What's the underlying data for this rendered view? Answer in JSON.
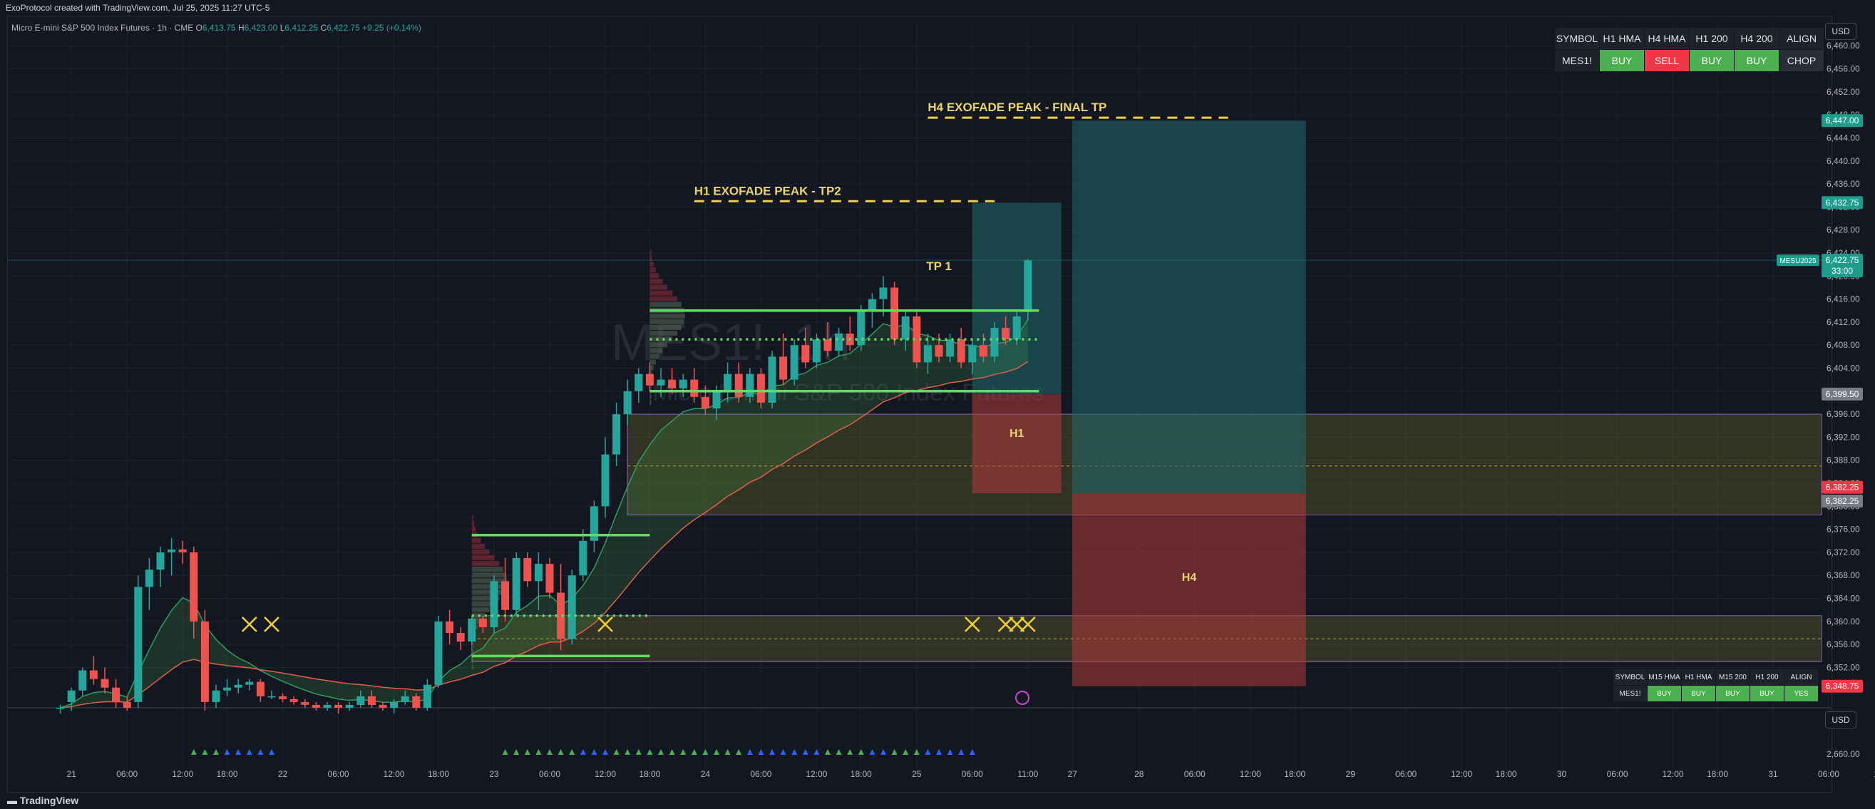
{
  "header": {
    "title": "ExoProtocol created with TradingView.com, Jul 25, 2025 11:27 UTC-5"
  },
  "infoline": {
    "symbol": "Micro E-mini S&P 500 Index Futures · 1h · CME",
    "o_label": "O",
    "o": "6,413.75",
    "h_label": "H",
    "h": "6,423.00",
    "l_label": "L",
    "l": "6,412.25",
    "c_label": "C",
    "c": "6,422.75",
    "change": "+9.25 (+0.14%)"
  },
  "currency_label": "USD",
  "footer": {
    "logo": "TradingView"
  },
  "watermark": {
    "symbol": "MES1!, 1h",
    "name": "Micro E-mini S&P 500 Index Futures"
  },
  "table_top": {
    "headers": [
      "SYMBOL",
      "H1 HMA",
      "H4 HMA",
      "H1 200",
      "H4 200",
      "ALIGN"
    ],
    "row": [
      "MES1!",
      "BUY",
      "SELL",
      "BUY",
      "BUY",
      "CHOP"
    ]
  },
  "table_bottom": {
    "headers": [
      "SYMBOL",
      "M15 HMA",
      "H1 HMA",
      "M15 200",
      "H1 200",
      "ALIGN"
    ],
    "row": [
      "MES1!",
      "BUY",
      "BUY",
      "BUY",
      "BUY",
      "YES"
    ]
  },
  "colors": {
    "background": "#131722",
    "up": "#26a69a",
    "down": "#ef5350",
    "level_line": "#5ee05a",
    "annotation": "#e8d66c",
    "zone_h1": "#a0a030",
    "zone_red": "#b03a3a",
    "zone_teal": "#1f6a6a"
  },
  "chart_data": {
    "type": "candlestick",
    "timeframe": "1h",
    "ylim": [
      6345,
      6463
    ],
    "y_ticks": [
      "6,460.00",
      "6,456.00",
      "6,452.00",
      "6,448.00",
      "6,444.00",
      "6,440.00",
      "6,436.00",
      "6,432.00",
      "6,428.00",
      "6,424.00",
      "6,420.00",
      "6,416.00",
      "6,412.00",
      "6,408.00",
      "6,404.00",
      "6,400.00",
      "6,396.00",
      "6,392.00",
      "6,388.00",
      "6,384.00",
      "6,380.00",
      "6,376.00",
      "6,372.00",
      "6,368.00",
      "6,364.00",
      "6,360.00",
      "6,356.00",
      "6,352.00"
    ],
    "x_ticks": [
      {
        "label": "21",
        "bar": 1
      },
      {
        "label": "06:00",
        "bar": 6
      },
      {
        "label": "12:00",
        "bar": 11
      },
      {
        "label": "18:00",
        "bar": 15
      },
      {
        "label": "22",
        "bar": 20
      },
      {
        "label": "06:00",
        "bar": 25
      },
      {
        "label": "12:00",
        "bar": 30
      },
      {
        "label": "18:00",
        "bar": 34
      },
      {
        "label": "23",
        "bar": 39
      },
      {
        "label": "06:00",
        "bar": 44
      },
      {
        "label": "12:00",
        "bar": 49
      },
      {
        "label": "18:00",
        "bar": 53
      },
      {
        "label": "24",
        "bar": 58
      },
      {
        "label": "06:00",
        "bar": 63
      },
      {
        "label": "12:00",
        "bar": 68
      },
      {
        "label": "18:00",
        "bar": 72
      },
      {
        "label": "25",
        "bar": 77
      },
      {
        "label": "06:00",
        "bar": 82
      },
      {
        "label": "11:00",
        "bar": 87
      },
      {
        "label": "27",
        "bar": 91
      },
      {
        "label": "28",
        "bar": 97
      },
      {
        "label": "06:00",
        "bar": 102
      },
      {
        "label": "12:00",
        "bar": 107
      },
      {
        "label": "18:00",
        "bar": 111
      },
      {
        "label": "29",
        "bar": 116
      },
      {
        "label": "06:00",
        "bar": 121
      },
      {
        "label": "12:00",
        "bar": 126
      },
      {
        "label": "18:00",
        "bar": 130
      },
      {
        "label": "30",
        "bar": 135
      },
      {
        "label": "06:00",
        "bar": 140
      },
      {
        "label": "12:00",
        "bar": 145
      },
      {
        "label": "18:00",
        "bar": 149
      },
      {
        "label": "31",
        "bar": 154
      },
      {
        "label": "06:00",
        "bar": 159
      },
      {
        "label": "12:00",
        "bar": 164
      }
    ],
    "candles": [
      [
        6345.0,
        6345.5,
        6344.0,
        6345.0
      ],
      [
        6346.0,
        6348.5,
        6344.5,
        6348.0
      ],
      [
        6348.0,
        6352.0,
        6347.0,
        6351.5
      ],
      [
        6351.5,
        6354.0,
        6349.0,
        6350.0
      ],
      [
        6350.0,
        6352.0,
        6347.5,
        6348.5
      ],
      [
        6348.5,
        6350.0,
        6345.0,
        6346.0
      ],
      [
        6346.0,
        6347.0,
        6344.5,
        6345.0
      ],
      [
        6346.0,
        6368.0,
        6345.0,
        6366.0
      ],
      [
        6366.0,
        6371.0,
        6362.0,
        6369.0
      ],
      [
        6369.0,
        6373.0,
        6366.0,
        6372.0
      ],
      [
        6372.0,
        6374.5,
        6368.0,
        6372.5
      ],
      [
        6372.5,
        6374.0,
        6370.0,
        6372.0
      ],
      [
        6372.0,
        6373.0,
        6357.0,
        6360.0
      ],
      [
        6360.0,
        6362.0,
        6344.5,
        6346.0
      ],
      [
        6346.0,
        6349.0,
        6345.0,
        6348.0
      ],
      [
        6348.0,
        6350.0,
        6347.0,
        6348.5
      ],
      [
        6348.5,
        6350.0,
        6347.5,
        6349.0
      ],
      [
        6349.0,
        6350.0,
        6348.0,
        6349.5
      ],
      [
        6349.5,
        6350.0,
        6346.0,
        6347.0
      ],
      [
        6347.0,
        6348.0,
        6346.5,
        6347.0
      ],
      [
        6347.0,
        6347.5,
        6346.0,
        6346.5
      ],
      [
        6346.5,
        6347.0,
        6345.5,
        6346.0
      ],
      [
        6346.0,
        6346.5,
        6345.0,
        6345.5
      ],
      [
        6345.5,
        6346.0,
        6344.5,
        6345.0
      ],
      [
        6345.0,
        6346.0,
        6344.5,
        6345.5
      ],
      [
        6345.5,
        6346.0,
        6344.0,
        6345.0
      ],
      [
        6345.0,
        6346.0,
        6344.5,
        6345.5
      ],
      [
        6345.5,
        6348.0,
        6345.0,
        6347.0
      ],
      [
        6347.0,
        6348.0,
        6345.0,
        6345.5
      ],
      [
        6345.5,
        6346.0,
        6344.5,
        6345.0
      ],
      [
        6345.0,
        6346.5,
        6344.0,
        6346.0
      ],
      [
        6346.0,
        6348.0,
        6345.5,
        6347.0
      ],
      [
        6347.0,
        6347.5,
        6344.5,
        6345.0
      ],
      [
        6345.0,
        6350.0,
        6344.5,
        6349.0
      ],
      [
        6349.0,
        6361.0,
        6348.5,
        6360.0
      ],
      [
        6360.0,
        6362.0,
        6356.0,
        6358.0
      ],
      [
        6358.0,
        6359.0,
        6355.0,
        6356.5
      ],
      [
        6356.5,
        6361.0,
        6356.0,
        6360.5
      ],
      [
        6360.5,
        6361.0,
        6358.0,
        6359.0
      ],
      [
        6359.0,
        6368.0,
        6358.0,
        6367.0
      ],
      [
        6367.0,
        6371.0,
        6360.0,
        6362.0
      ],
      [
        6362.0,
        6372.0,
        6361.0,
        6371.0
      ],
      [
        6371.0,
        6372.0,
        6366.0,
        6367.0
      ],
      [
        6367.0,
        6372.0,
        6362.0,
        6370.0
      ],
      [
        6370.0,
        6371.0,
        6364.0,
        6365.0
      ],
      [
        6365.0,
        6370.0,
        6355.0,
        6357.0
      ],
      [
        6357.0,
        6369.0,
        6356.0,
        6368.0
      ],
      [
        6368.0,
        6376.0,
        6367.0,
        6374.0
      ],
      [
        6374.0,
        6381.0,
        6372.0,
        6380.0
      ],
      [
        6380.0,
        6392.0,
        6378.0,
        6389.0
      ],
      [
        6389.0,
        6398.0,
        6387.0,
        6396.0
      ],
      [
        6396.0,
        6402.0,
        6394.0,
        6400.0
      ],
      [
        6400.0,
        6404.0,
        6398.0,
        6403.0
      ],
      [
        6403.0,
        6405.0,
        6400.0,
        6401.0
      ],
      [
        6401.0,
        6404.0,
        6399.0,
        6402.0
      ],
      [
        6402.0,
        6404.0,
        6399.5,
        6400.5
      ],
      [
        6400.5,
        6403.0,
        6399.0,
        6402.0
      ],
      [
        6402.0,
        6404.0,
        6398.0,
        6399.0
      ],
      [
        6399.0,
        6401.0,
        6396.0,
        6397.0
      ],
      [
        6397.0,
        6401.0,
        6395.0,
        6400.0
      ],
      [
        6400.0,
        6405.0,
        6398.0,
        6403.0
      ],
      [
        6403.0,
        6405.0,
        6398.0,
        6399.0
      ],
      [
        6399.0,
        6404.0,
        6398.0,
        6403.0
      ],
      [
        6403.0,
        6404.0,
        6397.0,
        6398.0
      ],
      [
        6398.0,
        6407.0,
        6397.0,
        6406.0
      ],
      [
        6406.0,
        6410.0,
        6401.0,
        6402.0
      ],
      [
        6402.0,
        6409.0,
        6401.0,
        6408.0
      ],
      [
        6408.0,
        6411.0,
        6404.0,
        6405.0
      ],
      [
        6405.0,
        6410.0,
        6404.0,
        6409.0
      ],
      [
        6409.0,
        6412.0,
        6406.0,
        6407.0
      ],
      [
        6407.0,
        6411.0,
        6406.0,
        6410.0
      ],
      [
        6410.0,
        6413.0,
        6407.0,
        6408.0
      ],
      [
        6408.0,
        6415.0,
        6407.0,
        6414.0
      ],
      [
        6414.0,
        6417.0,
        6411.0,
        6416.0
      ],
      [
        6416.0,
        6420.0,
        6413.0,
        6418.0
      ],
      [
        6418.0,
        6419.0,
        6408.0,
        6409.0
      ],
      [
        6409.0,
        6414.0,
        6407.0,
        6413.0
      ],
      [
        6413.0,
        6414.0,
        6404.0,
        6405.0
      ],
      [
        6405.0,
        6410.0,
        6403.0,
        6408.0
      ],
      [
        6408.0,
        6410.0,
        6405.0,
        6406.0
      ],
      [
        6406.0,
        6410.0,
        6405.0,
        6409.0
      ],
      [
        6409.0,
        6411.0,
        6404.0,
        6405.0
      ],
      [
        6405.0,
        6409.0,
        6403.0,
        6408.0
      ],
      [
        6408.0,
        6410.0,
        6405.0,
        6406.0
      ],
      [
        6406.0,
        6412.0,
        6405.0,
        6411.0
      ],
      [
        6411.0,
        6413.0,
        6408.0,
        6409.0
      ],
      [
        6409.0,
        6414.0,
        6408.0,
        6413.0
      ],
      [
        6413.75,
        6423.0,
        6412.25,
        6422.75
      ]
    ],
    "candle_start_bar": 0,
    "levels": [
      {
        "bar_start": 53,
        "bar_end": 88,
        "price": 6414.0,
        "style": "solid"
      },
      {
        "bar_start": 53,
        "bar_end": 88,
        "price": 6409.0,
        "style": "dotted"
      },
      {
        "bar_start": 53,
        "bar_end": 88,
        "price": 6400.0,
        "style": "solid"
      },
      {
        "bar_start": 37,
        "bar_end": 53,
        "price": 6375.0,
        "style": "solid"
      },
      {
        "bar_start": 37,
        "bar_end": 53,
        "price": 6361.0,
        "style": "dotted"
      },
      {
        "bar_start": 37,
        "bar_end": 53,
        "price": 6354.0,
        "style": "solid"
      }
    ],
    "zones": [
      {
        "id": "h1",
        "label": "H1",
        "bar_start": 51,
        "bar_end": 170,
        "top": 6396.0,
        "bottom": 6378.5,
        "mid": 6387.0
      },
      {
        "id": "lower",
        "label": "",
        "bar_start": 37,
        "bar_end": 170,
        "top": 6361.0,
        "bottom": 6353.0,
        "mid": 6357.0
      }
    ],
    "positions": [
      {
        "id": "h1-pos",
        "bar_start": 82,
        "bar_end": 90,
        "entry": 6399.5,
        "target": 6432.75,
        "stop": 6382.25,
        "label": "H1"
      },
      {
        "id": "h4-pos",
        "bar_start": 91,
        "bar_end": 112,
        "entry": 6382.25,
        "target": 6447.0,
        "stop": 6348.75,
        "label": "H4"
      }
    ],
    "annotations": [
      {
        "text": "H4 EXOFADE PEAK - FINAL TP",
        "bar_start": 78,
        "bar_end": 105,
        "price": 6447.5
      },
      {
        "text": "H1 EXOFADE PEAK -  TP2",
        "bar_start": 57,
        "bar_end": 84,
        "price": 6433.0
      },
      {
        "text": "TP 1",
        "bar": 79,
        "price": 6421.0
      }
    ],
    "crosses": [
      {
        "bar": 17,
        "price": 6359.5
      },
      {
        "bar": 19,
        "price": 6359.5
      },
      {
        "bar": 49,
        "price": 6359.5
      },
      {
        "bar": 82,
        "price": 6359.5
      },
      {
        "bar": 85,
        "price": 6359.5
      },
      {
        "bar": 86,
        "price": 6359.5
      },
      {
        "bar": 87,
        "price": 6359.5
      }
    ],
    "price_labels": [
      {
        "text": "6,447.00",
        "price": 6447.0,
        "color": "#1e9d8c"
      },
      {
        "text": "6,432.75",
        "price": 6432.75,
        "color": "#1e9d8c"
      },
      {
        "text": "6,422.75",
        "price": 6422.75,
        "color": "#1e9d8c"
      },
      {
        "text": "33:00",
        "price": 6420.9,
        "color": "#1e9d8c"
      },
      {
        "text": "6,399.50",
        "price": 6399.5,
        "color": "#787b86"
      },
      {
        "text": "6,382.25",
        "price": 6383.3,
        "color": "#f23645"
      },
      {
        "text": "6,382.25",
        "price": 6380.9,
        "color": "#787b86"
      },
      {
        "text": "6,348.75",
        "price": 6348.75,
        "color": "#f23645"
      }
    ],
    "symbol_tag": {
      "text": "MESU2025",
      "price": 6422.75
    },
    "sub_pane": {
      "tick_label": "2,660.00",
      "markers": [
        {
          "bar": 12,
          "color": "#4caf50"
        },
        {
          "bar": 13,
          "color": "#4caf50"
        },
        {
          "bar": 14,
          "color": "#4caf50"
        },
        {
          "bar": 15,
          "color": "#2962ff"
        },
        {
          "bar": 16,
          "color": "#2962ff"
        },
        {
          "bar": 17,
          "color": "#2962ff"
        },
        {
          "bar": 18,
          "color": "#2962ff"
        },
        {
          "bar": 19,
          "color": "#2962ff"
        },
        {
          "bar": 40,
          "color": "#4caf50"
        },
        {
          "bar": 41,
          "color": "#4caf50"
        },
        {
          "bar": 42,
          "color": "#4caf50"
        },
        {
          "bar": 43,
          "color": "#4caf50"
        },
        {
          "bar": 44,
          "color": "#4caf50"
        },
        {
          "bar": 45,
          "color": "#4caf50"
        },
        {
          "bar": 46,
          "color": "#4caf50"
        },
        {
          "bar": 47,
          "color": "#2962ff"
        },
        {
          "bar": 48,
          "color": "#2962ff"
        },
        {
          "bar": 49,
          "color": "#2962ff"
        },
        {
          "bar": 50,
          "color": "#4caf50"
        },
        {
          "bar": 51,
          "color": "#4caf50"
        },
        {
          "bar": 52,
          "color": "#4caf50"
        },
        {
          "bar": 53,
          "color": "#4caf50"
        },
        {
          "bar": 54,
          "color": "#4caf50"
        },
        {
          "bar": 55,
          "color": "#4caf50"
        },
        {
          "bar": 56,
          "color": "#4caf50"
        },
        {
          "bar": 57,
          "color": "#4caf50"
        },
        {
          "bar": 58,
          "color": "#4caf50"
        },
        {
          "bar": 59,
          "color": "#4caf50"
        },
        {
          "bar": 60,
          "color": "#4caf50"
        },
        {
          "bar": 61,
          "color": "#4caf50"
        },
        {
          "bar": 62,
          "color": "#2962ff"
        },
        {
          "bar": 63,
          "color": "#2962ff"
        },
        {
          "bar": 64,
          "color": "#2962ff"
        },
        {
          "bar": 65,
          "color": "#2962ff"
        },
        {
          "bar": 66,
          "color": "#2962ff"
        },
        {
          "bar": 67,
          "color": "#2962ff"
        },
        {
          "bar": 68,
          "color": "#2962ff"
        },
        {
          "bar": 69,
          "color": "#4caf50"
        },
        {
          "bar": 70,
          "color": "#4caf50"
        },
        {
          "bar": 71,
          "color": "#4caf50"
        },
        {
          "bar": 72,
          "color": "#4caf50"
        },
        {
          "bar": 73,
          "color": "#2962ff"
        },
        {
          "bar": 74,
          "color": "#2962ff"
        },
        {
          "bar": 75,
          "color": "#4caf50"
        },
        {
          "bar": 76,
          "color": "#4caf50"
        },
        {
          "bar": 77,
          "color": "#4caf50"
        },
        {
          "bar": 78,
          "color": "#2962ff"
        },
        {
          "bar": 79,
          "color": "#2962ff"
        },
        {
          "bar": 80,
          "color": "#2962ff"
        },
        {
          "bar": 81,
          "color": "#2962ff"
        },
        {
          "bar": 82,
          "color": "#2962ff"
        }
      ]
    }
  }
}
